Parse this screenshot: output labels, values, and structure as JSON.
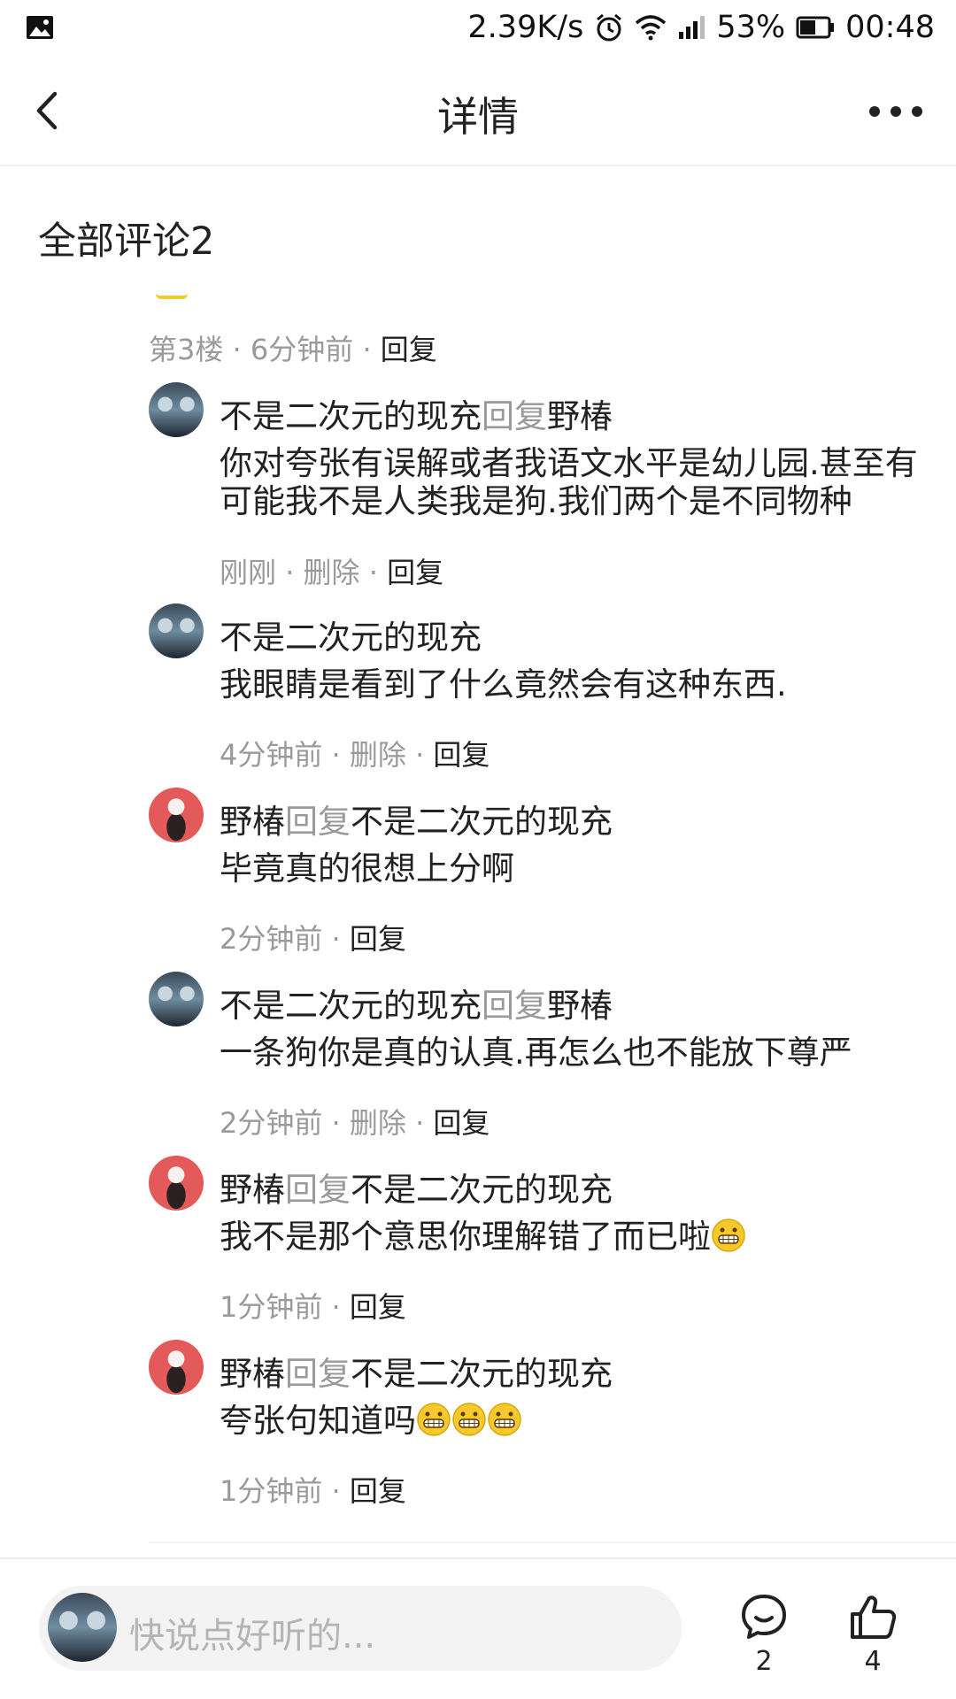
{
  "status_bar": {
    "speed": "2.39K/s",
    "battery": "53%",
    "time": "00:48"
  },
  "nav": {
    "title": "详情"
  },
  "comments": {
    "title": "全部评论2",
    "floor_meta": {
      "floor": "第3楼",
      "time": "6分钟前",
      "reply": "回复"
    },
    "replies": [
      {
        "avatar": "blue",
        "author": "不是二次元的现充",
        "reply_word": "回复",
        "target": "野椿",
        "text": "你对夸张有误解或者我语文水平是幼儿园.甚至有可能我不是人类我是狗.我们两个是不同物种",
        "time": "刚刚",
        "delete": "删除",
        "reply": "回复"
      },
      {
        "avatar": "blue",
        "author": "不是二次元的现充",
        "reply_word": "",
        "target": "",
        "text": "我眼睛是看到了什么竟然会有这种东西.",
        "time": "4分钟前",
        "delete": "删除",
        "reply": "回复"
      },
      {
        "avatar": "red",
        "author": "野椿",
        "reply_word": "回复",
        "target": "不是二次元的现充",
        "text": "毕竟真的很想上分啊",
        "time": "2分钟前",
        "delete": "",
        "reply": "回复"
      },
      {
        "avatar": "blue",
        "author": "不是二次元的现充",
        "reply_word": "回复",
        "target": "野椿",
        "text": "一条狗你是真的认真.再怎么也不能放下尊严",
        "time": "2分钟前",
        "delete": "删除",
        "reply": "回复"
      },
      {
        "avatar": "red",
        "author": "野椿",
        "reply_word": "回复",
        "target": "不是二次元的现充",
        "text": "我不是那个意思你理解错了而已啦",
        "emoji_count": 1,
        "time": "1分钟前",
        "delete": "",
        "reply": "回复"
      },
      {
        "avatar": "red",
        "author": "野椿",
        "reply_word": "回复",
        "target": "不是二次元的现充",
        "text": "夸张句知道吗",
        "emoji_count": 3,
        "time": "1分钟前",
        "delete": "",
        "reply": "回复"
      }
    ]
  },
  "bottom_bar": {
    "placeholder": "快说点好听的...",
    "comment_count": "2",
    "like_count": "4"
  },
  "colors": {
    "accent_emoji": "#f5c92b",
    "muted_text": "#999999",
    "avatar_red": "#e45a5a"
  },
  "icons": [
    "image-icon",
    "alarm-icon",
    "wifi-icon",
    "signal-icon",
    "battery-icon",
    "back-icon",
    "more-icon",
    "comment-icon",
    "like-icon",
    "grin-emoji-icon"
  ]
}
